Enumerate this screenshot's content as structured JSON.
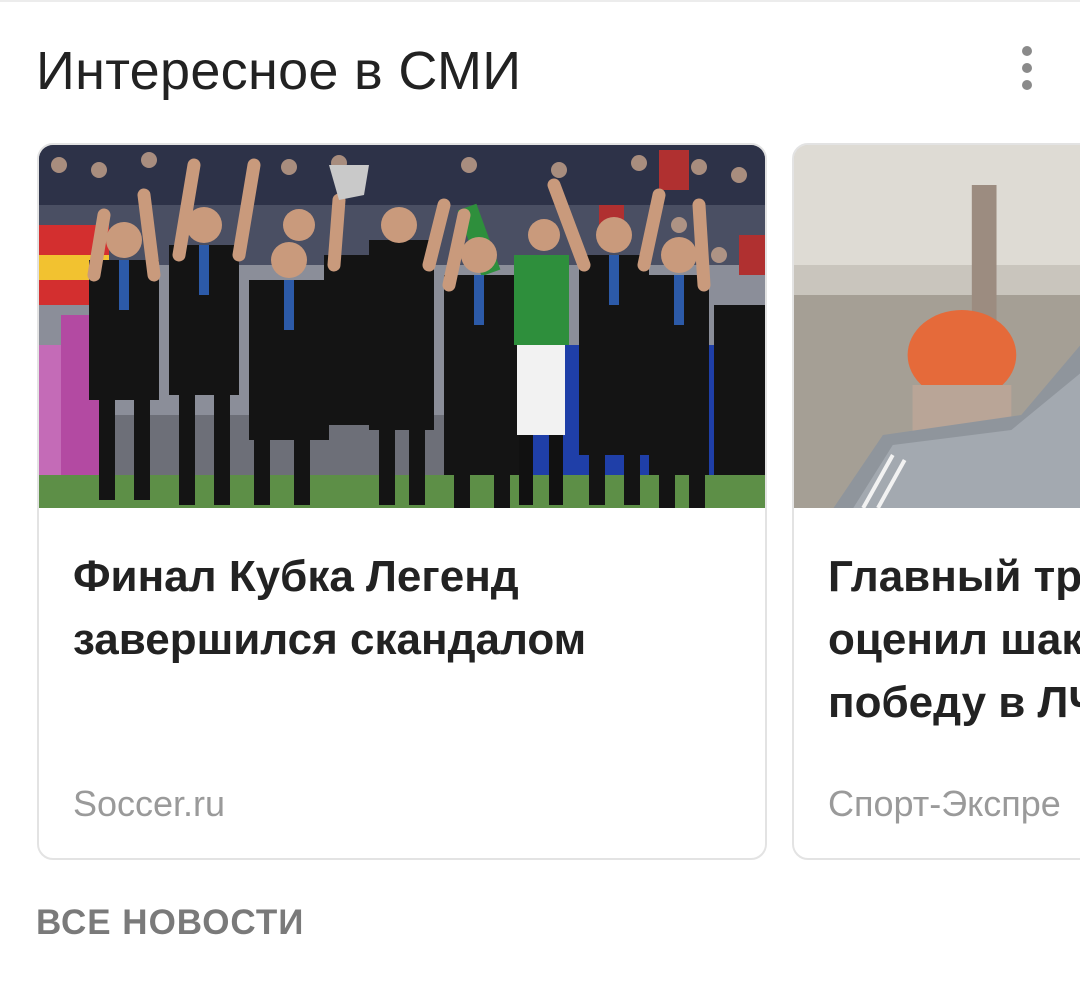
{
  "header": {
    "title": "Интересное в СМИ",
    "menu_icon": "more-vertical-icon"
  },
  "cards": [
    {
      "title": "Финал Кубка Легенд завершился скандалом",
      "source": "Soccer.ru",
      "image": "football-team-celebration-photo"
    },
    {
      "title_lines": [
        "Главный тр",
        "оценил шак",
        "победу в ЛЧ"
      ],
      "source": "Спорт-Экспре",
      "image": "coach-portrait-photo"
    }
  ],
  "footer": {
    "all_news_label": "ВСЕ НОВОСТИ"
  },
  "colors": {
    "title_text": "#222222",
    "source_text": "#9a9a9a",
    "link_text": "#7a7a7a",
    "card_border": "#e3e3e3"
  }
}
